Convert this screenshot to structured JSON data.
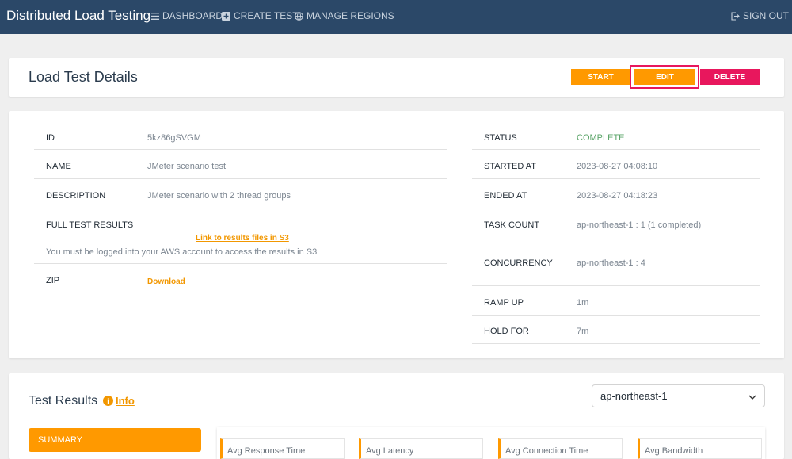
{
  "nav": {
    "brand": "Distributed Load Testing",
    "dashboard": "DASHBOARD",
    "create_test": "CREATE TEST",
    "manage_regions": "MANAGE REGIONS",
    "sign_out": "SIGN OUT"
  },
  "header": {
    "title": "Load Test Details",
    "start": "START",
    "edit": "EDIT",
    "delete": "DELETE"
  },
  "details": {
    "left": {
      "id_label": "ID",
      "id_value": "5kz86gSVGM",
      "name_label": "NAME",
      "name_value": "JMeter scenario test",
      "description_label": "DESCRIPTION",
      "description_value": "JMeter scenario with 2 thread groups",
      "results_label": "FULL TEST RESULTS",
      "results_link": "Link to results files in S3",
      "results_note": "You must be logged into your AWS account to access the results in S3",
      "zip_label": "ZIP",
      "zip_link": "Download"
    },
    "right": {
      "status_label": "STATUS",
      "status_value": "COMPLETE",
      "started_label": "STARTED AT",
      "started_value": "2023-08-27 04:08:10",
      "ended_label": "ENDED AT",
      "ended_value": "2023-08-27 04:18:23",
      "task_label": "TASK COUNT",
      "task_value": "ap-northeast-1 : 1 (1 completed)",
      "concurrency_label": "CONCURRENCY",
      "concurrency_value": "ap-northeast-1 : 4",
      "ramp_label": "RAMP UP",
      "ramp_value": "1m",
      "hold_label": "HOLD FOR",
      "hold_value": "7m"
    }
  },
  "results": {
    "title": "Test Results",
    "info": "Info",
    "region": "ap-northeast-1",
    "summary_tab": "SUMMARY",
    "metrics": [
      "Avg Response Time",
      "Avg Latency",
      "Avg Connection Time",
      "Avg Bandwidth"
    ]
  },
  "colors": {
    "accent": "#ff9900",
    "danger": "#e8175d",
    "nav_bg": "#2b4868",
    "status_complete": "#5aa468"
  }
}
